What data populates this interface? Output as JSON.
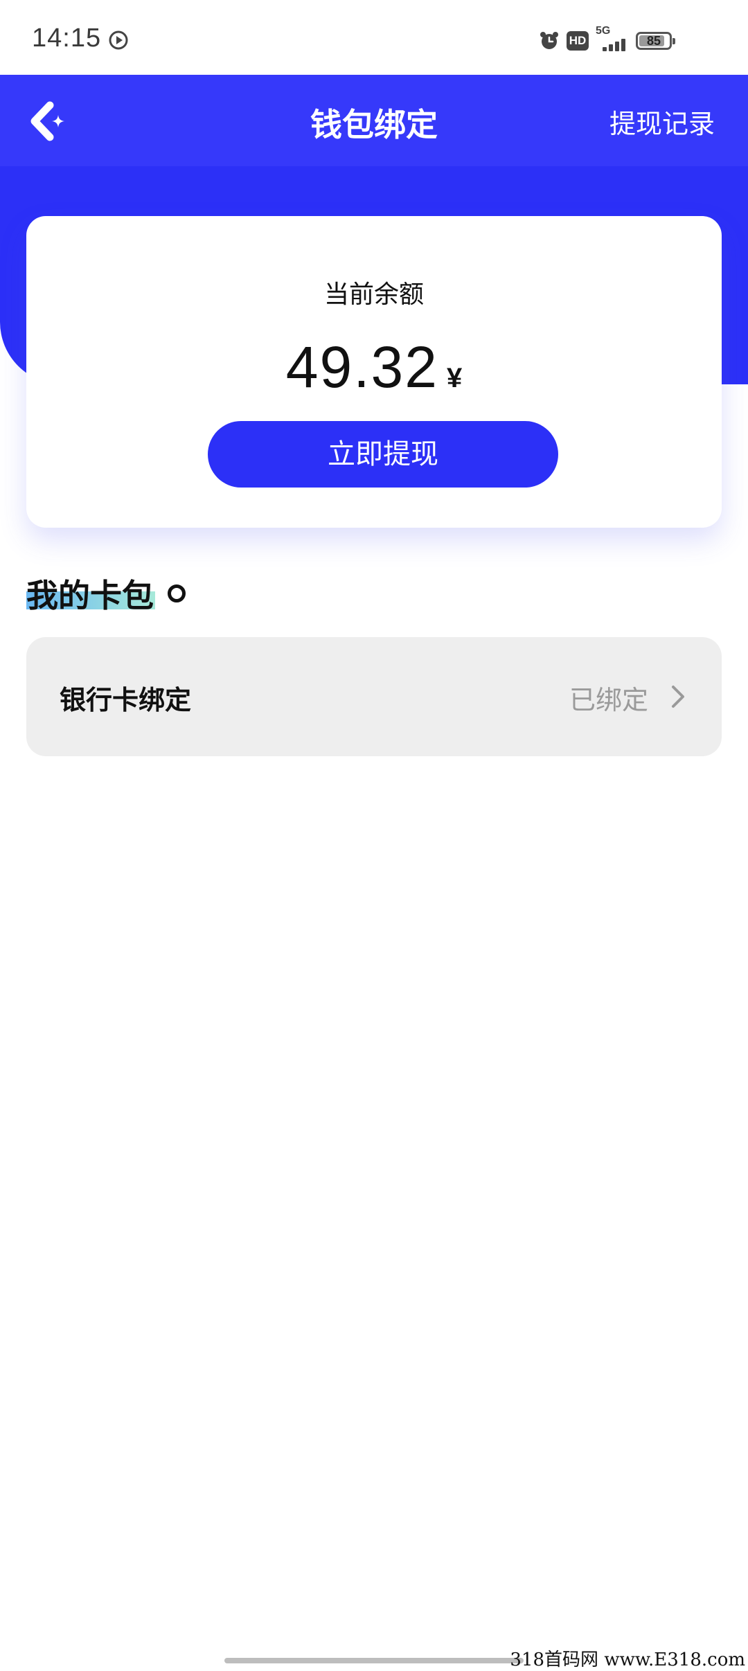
{
  "status_bar": {
    "time": "14:15",
    "network": "5G",
    "hd": "HD",
    "battery": "85",
    "battery_level": 0.85
  },
  "header": {
    "title": "钱包绑定",
    "right_link": "提现记录"
  },
  "balance_card": {
    "label": "当前余额",
    "amount": "49.32",
    "currency": "¥",
    "withdraw_button": "立即提现"
  },
  "cards_section": {
    "title": "我的卡包",
    "items": [
      {
        "label": "银行卡绑定",
        "status": "已绑定"
      }
    ]
  },
  "watermark": "318首码网 www.E318.com",
  "colors": {
    "primary": "#3639fa",
    "primary_dark": "#2c30f7",
    "row_bg": "#eeeeee",
    "muted_text": "#9a9a9a"
  }
}
